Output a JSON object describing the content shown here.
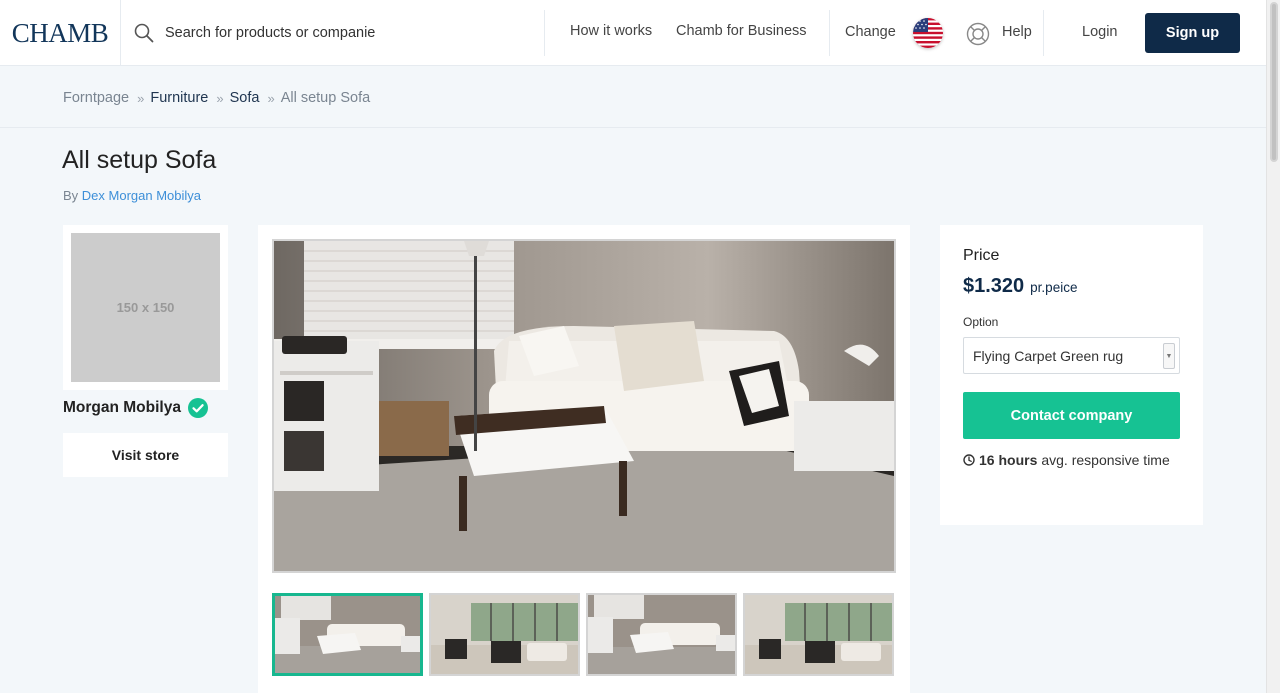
{
  "header": {
    "logo": "CHAMB",
    "search_placeholder": "Search for products or companies",
    "nav": {
      "how_it_works": "How it works",
      "for_business": "Chamb for Business",
      "change": "Change",
      "help": "Help",
      "login": "Login",
      "signup": "Sign up"
    }
  },
  "breadcrumb": [
    "Forntpage",
    "Furniture",
    "Sofa",
    "All setup Sofa"
  ],
  "product": {
    "title": "All setup Sofa",
    "by_prefix": "By",
    "company": "Dex Morgan Mobilya"
  },
  "seller": {
    "logo_placeholder": "150 x 150",
    "name": "Morgan Mobilya",
    "visit_store": "Visit store"
  },
  "gallery": {
    "thumbnails": [
      "living-room-sofa",
      "open-living-room",
      "living-room-sofa",
      "open-living-room"
    ],
    "active_index": 0
  },
  "pricing": {
    "label": "Price",
    "value": "$1.320",
    "unit": "pr.peice",
    "option_label": "Option",
    "option_selected": "Flying Carpet Green rug",
    "contact_button": "Contact company",
    "response_value": "16 hours",
    "response_suffix": "avg. responsive time"
  },
  "colors": {
    "brand_navy": "#0f2a48",
    "accent_green": "#16c293",
    "link_blue": "#3d8fd8"
  }
}
